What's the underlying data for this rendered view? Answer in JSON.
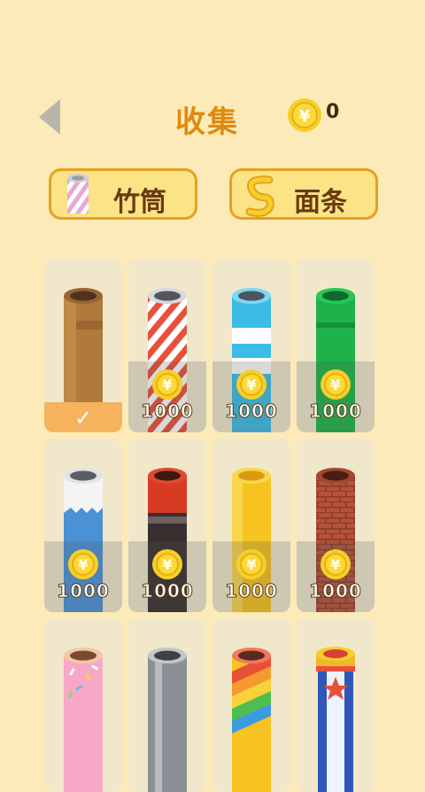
{
  "header": {
    "title": "收集",
    "coin_count": "0",
    "coin_symbol": "¥"
  },
  "categories": [
    {
      "label": "竹筒",
      "selected": true
    },
    {
      "label": "面条",
      "selected": false
    }
  ],
  "colors": {
    "background": "#fcebb8",
    "accent": "#e08a11",
    "coin": "#f7cf2a"
  },
  "items": [
    {
      "name": "brown-tube",
      "status": "selected",
      "price": "",
      "check": "✓"
    },
    {
      "name": "candy-stripe-tube",
      "status": "locked",
      "price": "1000"
    },
    {
      "name": "blue-white-tube",
      "status": "locked",
      "price": "1000"
    },
    {
      "name": "green-tube",
      "status": "locked",
      "price": "1000"
    },
    {
      "name": "silver-blue-tube",
      "status": "locked",
      "price": "1000"
    },
    {
      "name": "red-black-tube",
      "status": "locked",
      "price": "1000"
    },
    {
      "name": "yellow-tube",
      "status": "locked",
      "price": "1000"
    },
    {
      "name": "brick-tube",
      "status": "locked",
      "price": "1000"
    },
    {
      "name": "sprinkle-tube",
      "status": "locked",
      "price": ""
    },
    {
      "name": "steel-tube",
      "status": "locked",
      "price": ""
    },
    {
      "name": "rainbow-tube",
      "status": "locked",
      "price": ""
    },
    {
      "name": "firework-tube",
      "status": "locked",
      "price": ""
    }
  ]
}
